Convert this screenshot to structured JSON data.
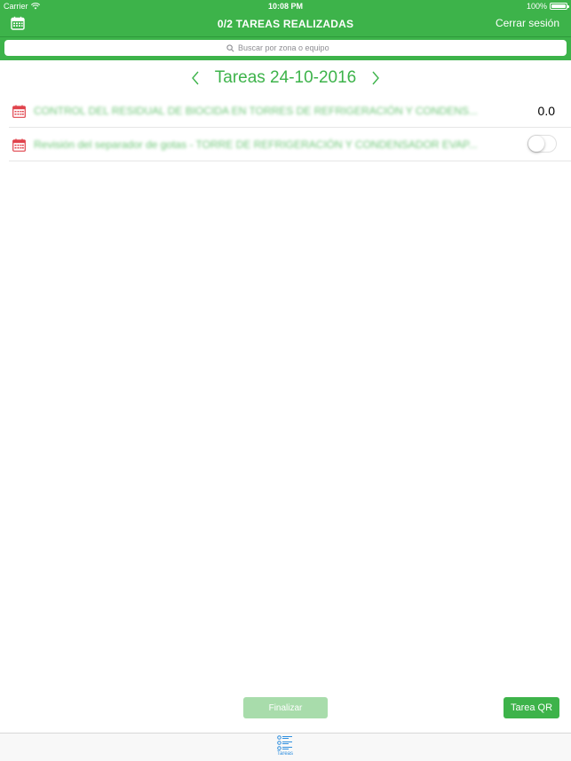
{
  "status_bar": {
    "carrier": "Carrier",
    "time": "10:08 PM",
    "battery": "100%"
  },
  "header": {
    "title": "0/2 TAREAS REALIZADAS",
    "logout_label": "Cerrar sesión",
    "calendar_icon": "calendar-icon"
  },
  "search": {
    "placeholder": "Buscar por zona o equipo",
    "value": ""
  },
  "date_nav": {
    "title": "Tareas 24-10-2016"
  },
  "tasks": [
    {
      "label": "CONTROL DEL RESIDUAL DE BIOCIDA EN TORRES DE REFRIGERACIÓN Y CONDENS...",
      "value": "0.0"
    },
    {
      "label": "Revisión del separador de gotas - TORRE DE REFRIGERACIÓN Y CONDENSADOR EVAP...",
      "toggle_on": false
    }
  ],
  "footer": {
    "finalize_label": "Finalizar",
    "qr_label": "Tarea QR"
  },
  "tab_bar": {
    "items": [
      {
        "label": "Tareas",
        "icon": "task-list-icon",
        "selected": true
      }
    ]
  },
  "colors": {
    "primary": "#3db34a",
    "primary_light": "#a8dcab",
    "tab_active": "#2f8fdf",
    "icon_red": "#e0434c"
  }
}
